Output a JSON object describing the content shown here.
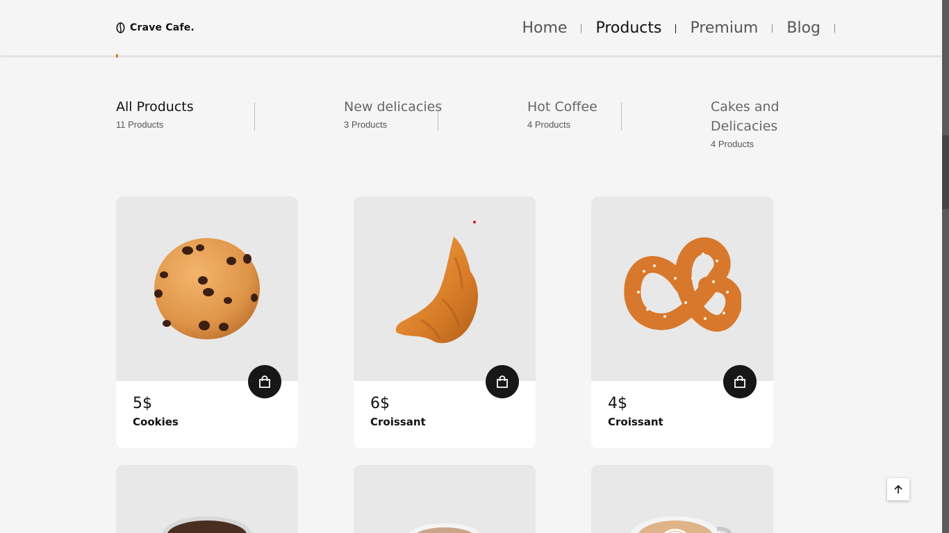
{
  "brand": {
    "name": "Crave Cafe."
  },
  "nav": [
    {
      "label": "Home"
    },
    {
      "label": "Products"
    },
    {
      "label": "Premium"
    },
    {
      "label": "Blog"
    }
  ],
  "categories": [
    {
      "title": "All Products",
      "count": "11 Products"
    },
    {
      "title": "New delicacies",
      "count": "3 Products"
    },
    {
      "title": "Hot Coffee",
      "count": "4 Products"
    },
    {
      "title": "Cakes and Delicacies",
      "count": "4 Products"
    }
  ],
  "products": [
    {
      "price": "5$",
      "name": "Cookies",
      "image": "cookie-image"
    },
    {
      "price": "6$",
      "name": "Croissant",
      "image": "croissant-image"
    },
    {
      "price": "4$",
      "name": "Croissant",
      "image": "pretzel-image"
    }
  ],
  "icons": {
    "cart": "shopping-bag-icon",
    "scroll_top": "arrow-up-icon",
    "logo": "coffee-bean-icon"
  },
  "colors": {
    "accent": "#d9822b",
    "button": "#171717",
    "active_nav": "#111111"
  }
}
